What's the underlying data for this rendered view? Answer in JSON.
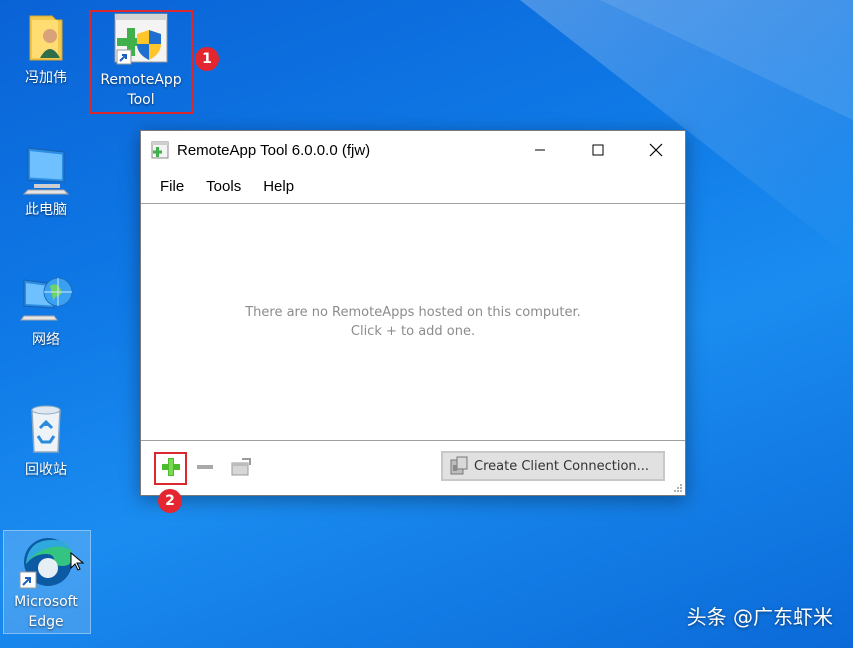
{
  "desktop": {
    "icons": [
      {
        "label": "冯加伟",
        "icon": "user-folder-icon"
      },
      {
        "label": "RemoteApp Tool",
        "label_line1": "RemoteApp",
        "label_line2": "Tool",
        "icon": "remoteapp-tool-icon"
      },
      {
        "label": "此电脑",
        "icon": "this-pc-icon"
      },
      {
        "label": "网络",
        "icon": "network-icon"
      },
      {
        "label": "回收站",
        "icon": "recycle-bin-icon"
      },
      {
        "label": "Microsoft Edge",
        "label_line1": "Microsoft",
        "label_line2": "Edge",
        "icon": "edge-icon"
      }
    ],
    "background_color": "#0f79e6"
  },
  "annotations": {
    "badge1": "1",
    "badge2": "2",
    "color": "#d9282f"
  },
  "window": {
    "title": "RemoteApp Tool 6.0.0.0 (fjw)",
    "controls": {
      "minimize": "minimize-icon",
      "maximize": "maximize-icon",
      "close": "close-icon"
    },
    "menu": [
      "File",
      "Tools",
      "Help"
    ],
    "empty_message_line1": "There are no RemoteApps hosted on this computer.",
    "empty_message_line2": "Click + to add one.",
    "toolbar": {
      "add": "plus-icon",
      "remove": "minus-icon",
      "properties": "properties-icon"
    },
    "create_client_button": "Create Client Connection..."
  },
  "watermark": "头条 @广东虾米"
}
